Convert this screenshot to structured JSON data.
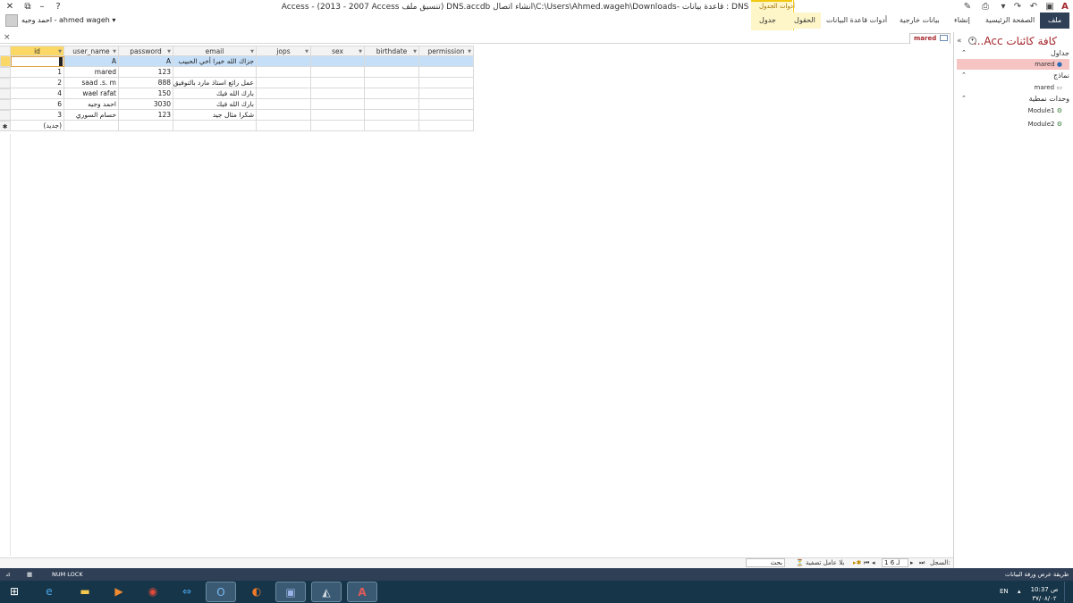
{
  "window": {
    "title": "Access - (2013 - 2007 Access تنسيق ملف) DNS.accdb انشاء اتصال\\C:\\Users\\Ahmed.wageh\\Downloads- قاعدة بيانات : DNS انشاء اتصال",
    "user_name": "احمد وجيه - ahmed wageh",
    "help_label": "?",
    "minimize_label": "–",
    "restore_label": "⧉",
    "close_label": "✕"
  },
  "ribbon": {
    "tabs": [
      "ملف",
      "الصفحة الرئيسية",
      "إنشاء",
      "بيانات خارجية",
      "أدوات قاعدة البيانات",
      "الحقول",
      "جدول"
    ],
    "context_group_label": "أدوات الجدول"
  },
  "doc_tab": {
    "label": "mared",
    "close_label": "×"
  },
  "table": {
    "columns": [
      "id",
      "user_name",
      "password",
      "email",
      "jops",
      "sex",
      "birthdate",
      "permission"
    ],
    "rows": [
      [
        "",
        "A",
        "A",
        "جزاك الله خيرا أخي الحبيب",
        "",
        "",
        "",
        ""
      ],
      [
        "1",
        "mared",
        "123",
        "",
        "",
        "",
        "",
        ""
      ],
      [
        "2",
        "saad .s. m",
        "888",
        "عمل رائع استاذ مارد بالتوفيق",
        "",
        "",
        "",
        ""
      ],
      [
        "4",
        "wael rafat",
        "150",
        "بارك الله فيك",
        "",
        "",
        "",
        ""
      ],
      [
        "6",
        "احمد وجيه",
        "3030",
        "بارك الله فيك",
        "",
        "",
        "",
        ""
      ],
      [
        "3",
        "حسام السوري",
        "123",
        "شكرا مثال جيد",
        "",
        "",
        "",
        ""
      ]
    ],
    "new_row_label": "(جديد)",
    "new_row_marker": "✱"
  },
  "record_nav": {
    "record_label": "السجل:",
    "position": "1 لـ 6",
    "filter_label": "بلا عامل تصفية",
    "search_placeholder": "بحث"
  },
  "nav_pane": {
    "title": "كافة كائنات Acc...",
    "groups": [
      {
        "label": "جداول",
        "items": [
          "mared"
        ]
      },
      {
        "label": "نماذج",
        "items": [
          "mared"
        ]
      },
      {
        "label": "وحدات نمطية",
        "items": [
          "Module1",
          "Module2"
        ]
      }
    ]
  },
  "status_bar": {
    "left_label": "NUM LOCK",
    "right_label": "طريقة عرض ورقة البيانات"
  },
  "taskbar": {
    "language": "EN",
    "time": "10:37 ص",
    "date": "٣٧/٠٨/٠٢"
  },
  "colors": {
    "access_red": "#a4262c",
    "file_tab": "#2e3f56",
    "status_bar": "#2e3f56",
    "taskbar": "#163548",
    "selector_yellow": "#fbd866",
    "highlight_row": "#c5dff8",
    "active_nav_item": "#f7c4c4"
  }
}
